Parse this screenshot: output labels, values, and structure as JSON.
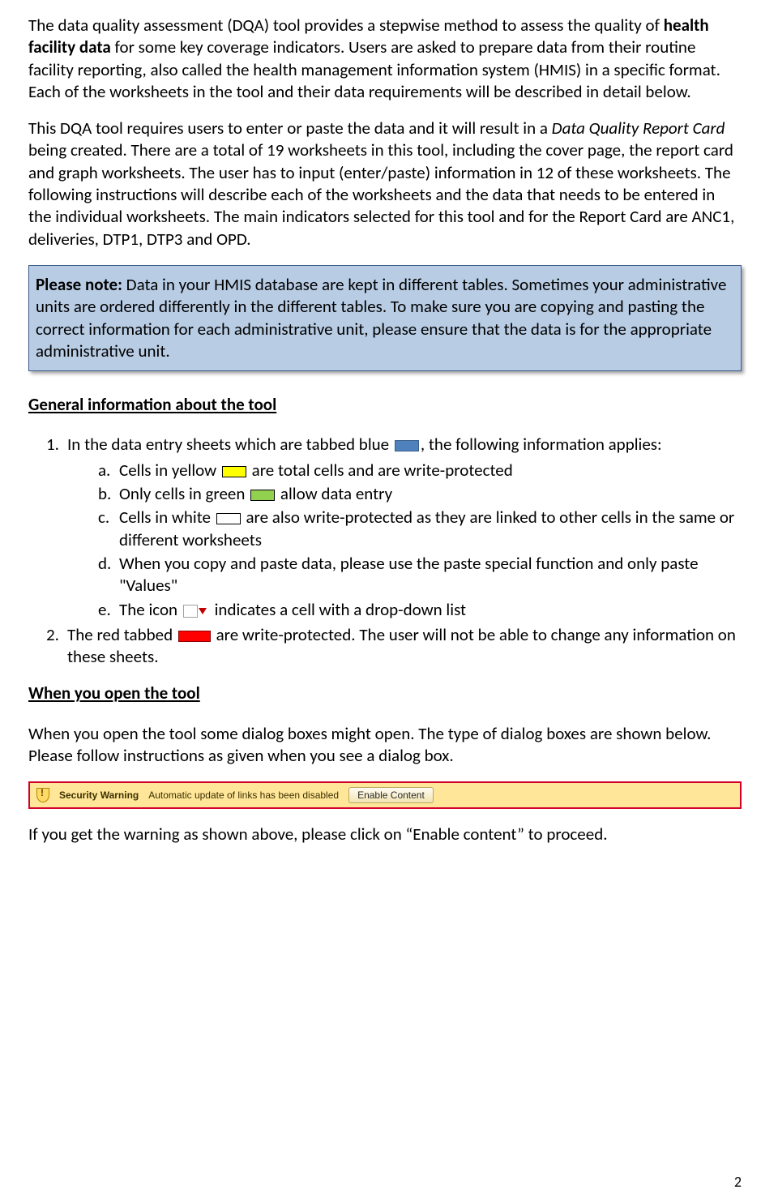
{
  "intro": {
    "p1_a": "The data quality assessment (DQA) tool provides a stepwise method to assess the quality of ",
    "p1_bold": "health facility data",
    "p1_b": " for some key coverage indicators.  Users are asked to prepare data from their routine facility reporting, also called the health management information system (HMIS) in a specific format.  Each of the worksheets in the tool and their data requirements will be described in detail below.",
    "p2_a": "This DQA tool requires users to enter or paste the data and it will result in a ",
    "p2_italic": "Data Quality Report Card",
    "p2_b": " being created.  There are a total of 19 worksheets in this tool, including the cover page, the report card and graph worksheets.  The user has to input (enter/paste) information in 12 of these worksheets.  The following instructions will describe each of the worksheets and the data that needs to be entered in the individual worksheets.  The main indicators selected for this tool and for the Report Card are ANC1, deliveries, DTP1, DTP3 and OPD."
  },
  "note": {
    "label": "Please note:",
    "text": " Data in your HMIS database are kept in different tables.  Sometimes your administrative units are ordered differently in the different tables. To make sure you are copying and pasting the correct information for each administrative unit, please ensure that the data is for the appropriate administrative unit."
  },
  "headings": {
    "general": "General information about the tool",
    "open": "When you open the tool"
  },
  "general": {
    "item1_a": "In the data entry sheets which are tabbed blue ",
    "item1_b": ", the following information applies:",
    "a_pre": "Cells in yellow ",
    "a_post": " are total cells and are write-protected",
    "b_pre": "Only cells in green ",
    "b_post": " allow data entry",
    "c_pre": "Cells in white ",
    "c_post": " are also write-protected as they are linked to other cells in the same or different worksheets",
    "d": "When you copy and paste data, please use the paste special function and only paste \"Values\"",
    "e_pre": "The icon ",
    "e_post": " indicates a cell with a drop-down list",
    "item2_a": "The red tabbed ",
    "item2_b": " are write-protected.  The user will not be able to change any information on these sheets."
  },
  "open_section": {
    "p1": "When you open the tool some dialog boxes might open.  The type of dialog boxes are shown below.  Please follow instructions as given when you see a dialog box.",
    "p2": "If you get the warning as shown above, please click on “Enable content” to proceed."
  },
  "warning_bar": {
    "title": "Security Warning",
    "message": "Automatic update of links has been disabled",
    "button": "Enable Content"
  },
  "page_number": "2"
}
